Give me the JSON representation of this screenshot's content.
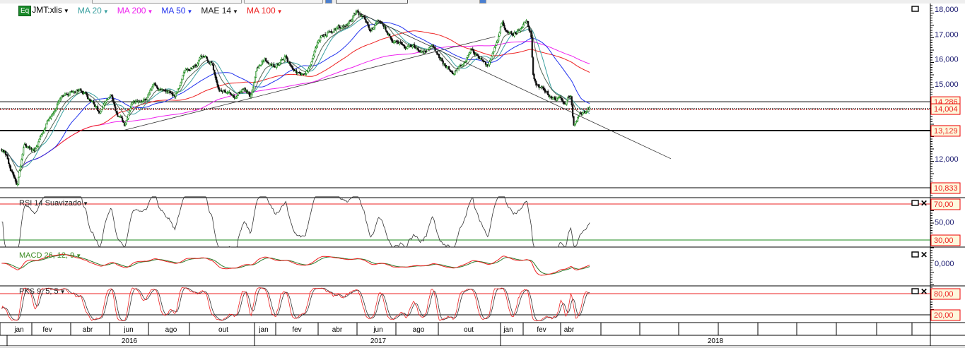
{
  "legend": {
    "badge": "Eq",
    "symbol": "JMT:xlis",
    "items": [
      {
        "label": "MA 20",
        "color": "#3aa0a0"
      },
      {
        "label": "MA 200",
        "color": "#ee22ee"
      },
      {
        "label": "MA 50",
        "color": "#2233ee"
      },
      {
        "label": "MAE 14",
        "color": "#222222"
      },
      {
        "label": "MA 100",
        "color": "#ee2222"
      }
    ]
  },
  "panels": {
    "rsi": {
      "label": "RSI 14 Suavizado",
      "ticks": [
        "70,00",
        "50,00",
        "30,00"
      ],
      "levels": [
        70,
        30
      ]
    },
    "macd": {
      "label": "MACD 26, 12, 9",
      "ticks": [
        "0,000"
      ]
    },
    "pks": {
      "label": "PKS 9; 5; 5",
      "ticks": [
        "80,00",
        "20,00"
      ],
      "levels": [
        80,
        20
      ]
    }
  },
  "colors": {
    "up": "#1b8a1b",
    "down": "#111111",
    "axis_text": "#1a1a70",
    "marker_text": "#ee2222",
    "marker_bg": "#fdf8dc"
  },
  "chart_data": {
    "type": "candlestick",
    "price_axis": {
      "ticks": [
        "18,000",
        "17,000",
        "16,000",
        "15,000",
        "12,000"
      ],
      "tick_values": [
        18000,
        17000,
        16000,
        15000,
        12000
      ]
    },
    "price_markers": [
      {
        "label": "14,286",
        "value": 14286,
        "style": "solid"
      },
      {
        "label": "14,004",
        "value": 14004,
        "style": "dotted"
      },
      {
        "label": "13,129",
        "value": 13129,
        "style": "thick"
      },
      {
        "label": "10,833",
        "value": 10833,
        "style": "solid"
      }
    ],
    "trendlines": [
      {
        "from": [
          "2016-06-23",
          13150
        ],
        "to": [
          "2017-12-24",
          16900
        ]
      },
      {
        "from": [
          "2017-06-02",
          17900
        ],
        "to": [
          "2018-09-10",
          12000
        ]
      }
    ],
    "close_points": [
      [
        "2015-12-24",
        12400
      ],
      [
        "2016-01-01",
        12000
      ],
      [
        "2016-01-16",
        10900
      ],
      [
        "2016-01-27",
        12600
      ],
      [
        "2016-02-10",
        12200
      ],
      [
        "2016-02-28",
        13500
      ],
      [
        "2016-03-15",
        14200
      ],
      [
        "2016-04-05",
        14700
      ],
      [
        "2016-04-16",
        14800
      ],
      [
        "2016-05-07",
        14200
      ],
      [
        "2016-05-17",
        13800
      ],
      [
        "2016-06-02",
        14500
      ],
      [
        "2016-06-13",
        13700
      ],
      [
        "2016-06-23",
        13300
      ],
      [
        "2016-07-03",
        14200
      ],
      [
        "2016-07-20",
        14200
      ],
      [
        "2016-08-05",
        14900
      ],
      [
        "2016-08-20",
        14800
      ],
      [
        "2016-09-05",
        14500
      ],
      [
        "2016-09-20",
        15500
      ],
      [
        "2016-10-10",
        15900
      ],
      [
        "2016-10-20",
        16200
      ],
      [
        "2016-10-31",
        15700
      ],
      [
        "2016-11-10",
        14800
      ],
      [
        "2016-12-01",
        14500
      ],
      [
        "2016-12-16",
        14900
      ],
      [
        "2016-12-26",
        14500
      ],
      [
        "2017-01-06",
        15700
      ],
      [
        "2017-01-17",
        16000
      ],
      [
        "2017-02-02",
        15700
      ],
      [
        "2017-02-17",
        16200
      ],
      [
        "2017-02-28",
        15500
      ],
      [
        "2017-03-15",
        15300
      ],
      [
        "2017-03-26",
        15700
      ],
      [
        "2017-04-06",
        16700
      ],
      [
        "2017-04-21",
        17100
      ],
      [
        "2017-05-06",
        17300
      ],
      [
        "2017-05-22",
        17500
      ],
      [
        "2017-06-02",
        17900
      ],
      [
        "2017-06-12",
        17700
      ],
      [
        "2017-06-22",
        17200
      ],
      [
        "2017-07-08",
        17500
      ],
      [
        "2017-07-23",
        16800
      ],
      [
        "2017-08-08",
        16500
      ],
      [
        "2017-08-23",
        16500
      ],
      [
        "2017-09-08",
        16300
      ],
      [
        "2017-09-23",
        16500
      ],
      [
        "2017-10-08",
        15900
      ],
      [
        "2017-10-23",
        15500
      ],
      [
        "2017-11-03",
        15700
      ],
      [
        "2017-11-18",
        16300
      ],
      [
        "2017-12-03",
        16000
      ],
      [
        "2017-12-13",
        15600
      ],
      [
        "2017-12-24",
        16500
      ],
      [
        "2018-01-03",
        17400
      ],
      [
        "2018-01-18",
        17000
      ],
      [
        "2018-01-29",
        17200
      ],
      [
        "2018-02-08",
        17500
      ],
      [
        "2018-02-15",
        17000
      ],
      [
        "2018-02-18",
        15500
      ],
      [
        "2018-02-23",
        15000
      ],
      [
        "2018-03-06",
        14800
      ],
      [
        "2018-03-16",
        14500
      ],
      [
        "2018-03-27",
        14400
      ],
      [
        "2018-04-07",
        14300
      ],
      [
        "2018-04-15",
        14600
      ],
      [
        "2018-04-19",
        13400
      ],
      [
        "2018-04-27",
        13800
      ],
      [
        "2018-05-13",
        14000
      ]
    ],
    "time_axis": {
      "months": [
        {
          "label": "jan",
          "date": "2016-01-01"
        },
        {
          "label": "fev",
          "date": "2016-02-15"
        },
        {
          "label": "abr",
          "date": "2016-04-10"
        },
        {
          "label": "jun",
          "date": "2016-06-08"
        },
        {
          "label": "ago",
          "date": "2016-08-10"
        },
        {
          "label": "out",
          "date": "2016-10-25"
        },
        {
          "label": "jan",
          "date": "2017-01-01"
        },
        {
          "label": "fev",
          "date": "2017-02-15"
        },
        {
          "label": "abr",
          "date": "2017-04-10"
        },
        {
          "label": "jun",
          "date": "2017-06-08"
        },
        {
          "label": "ago",
          "date": "2017-08-10"
        },
        {
          "label": "out",
          "date": "2017-10-25"
        },
        {
          "label": "jan",
          "date": "2018-01-03"
        },
        {
          "label": "fev",
          "date": "2018-02-20"
        },
        {
          "label": "abr",
          "date": "2018-04-05"
        }
      ],
      "years": [
        "2016",
        "2017",
        "2018"
      ]
    }
  }
}
